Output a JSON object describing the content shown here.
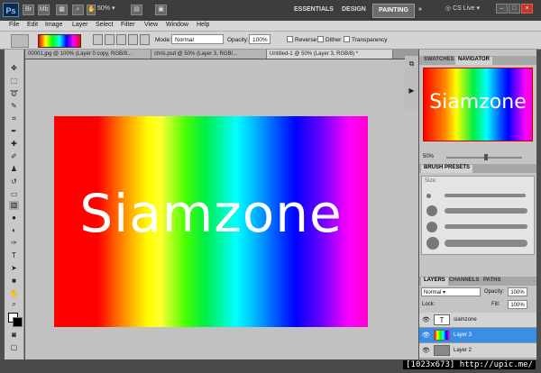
{
  "appbar": {
    "logo": "Ps",
    "zoom": "50%",
    "workspaces": [
      "ESSENTIALS",
      "DESIGN",
      "PAINTING"
    ],
    "workspace_more": "»",
    "cs_live": "CS Live",
    "win_minimize": "–",
    "win_restore": "□",
    "win_close": "×"
  },
  "menu": [
    "File",
    "Edit",
    "Image",
    "Layer",
    "Select",
    "Filter",
    "View",
    "Window",
    "Help"
  ],
  "options": {
    "mode_label": "Mode:",
    "mode_value": "Normal",
    "opacity_label": "Opacity:",
    "opacity_value": "100%",
    "reverse": "Reverse",
    "dither": "Dither",
    "transparency": "Transparency"
  },
  "tabs": [
    "00001.jpg @ 100% (Layer 0 copy, RGB/8...",
    "chris.psd @ 50% (Layer 3, RGB/...",
    "Untitled-1 @ 50% (Layer 3, RGB/8) *"
  ],
  "canvas": {
    "text": "Siamzone"
  },
  "navigator": {
    "tabs": [
      "SWATCHES",
      "NAVIGATOR"
    ],
    "thumb_text": "Siamzone",
    "zoom": "50%"
  },
  "brush": {
    "title": "BRUSH PRESETS",
    "size_label": "Size:"
  },
  "layers": {
    "tabs": [
      "LAYERS",
      "CHANNELS",
      "PATHS"
    ],
    "blend_mode": "Normal",
    "opacity_label": "Opacity:",
    "opacity_value": "100%",
    "lock_label": "Lock:",
    "fill_label": "Fill:",
    "fill_value": "100%",
    "items": [
      {
        "name": "siamzone",
        "thumb": "T"
      },
      {
        "name": "Layer 3"
      },
      {
        "name": "Layer 2"
      }
    ]
  },
  "watermark": "[1023x673] http://upic.me/"
}
